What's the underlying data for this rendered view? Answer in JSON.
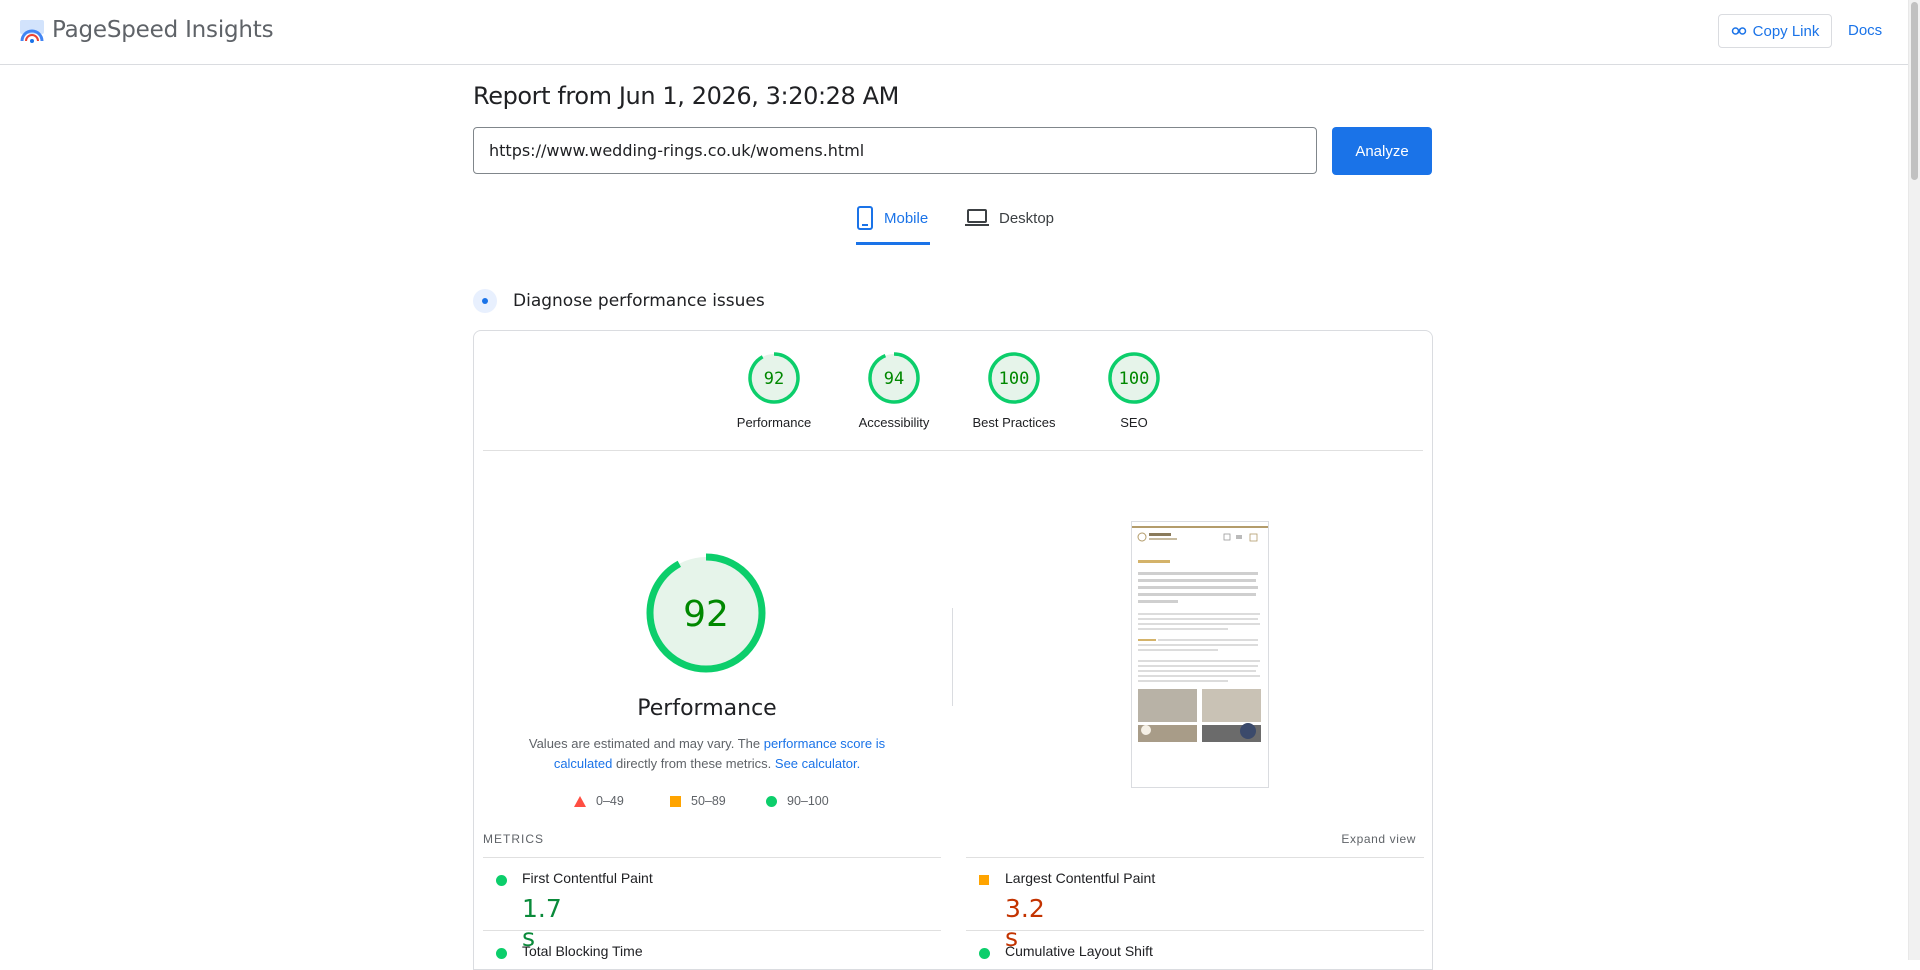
{
  "header": {
    "brand": "PageSpeed Insights",
    "copy_link": "Copy Link",
    "docs": "Docs"
  },
  "report": {
    "title": "Report from Jun 1, 2026, 3:20:28 AM",
    "url": "https://www.wedding-rings.co.uk/womens.html",
    "analyze": "Analyze"
  },
  "tabs": [
    {
      "label": "Mobile",
      "active": true,
      "icon": "smartphone-icon"
    },
    {
      "label": "Desktop",
      "active": false,
      "icon": "laptop-icon"
    }
  ],
  "diagnose": {
    "title": "Diagnose performance issues"
  },
  "scores": [
    {
      "label": "Performance",
      "value": 92
    },
    {
      "label": "Accessibility",
      "value": 94
    },
    {
      "label": "Best Practices",
      "value": 100
    },
    {
      "label": "SEO",
      "value": 100
    }
  ],
  "performance": {
    "score": 92,
    "title": "Performance",
    "note_prefix": "Values are estimated and may vary. The ",
    "note_link1": "performance score is calculated",
    "note_middle": " directly from these metrics. ",
    "note_link2": "See calculator.",
    "legend": [
      {
        "range": "0–49",
        "color": "#ff4e42",
        "shape": "triangle"
      },
      {
        "range": "50–89",
        "color": "#ffa400",
        "shape": "square"
      },
      {
        "range": "90–100",
        "color": "#0cce6b",
        "shape": "circle"
      }
    ]
  },
  "metrics": {
    "label": "METRICS",
    "expand": "Expand view",
    "items": [
      {
        "name": "First Contentful Paint",
        "value": "1.7 s",
        "status": "good",
        "color": "#0a8a3a"
      },
      {
        "name": "Largest Contentful Paint",
        "value": "3.2 s",
        "status": "average",
        "color": "#c33300"
      },
      {
        "name": "Total Blocking Time",
        "value": "",
        "status": "good",
        "color": "#0a8a3a"
      },
      {
        "name": "Cumulative Layout Shift",
        "value": "",
        "status": "good",
        "color": "#0a8a3a"
      }
    ]
  },
  "colors": {
    "accent": "#1a73e8",
    "pass": "#0cce6b",
    "pass_fill": "#e6f4ea",
    "pass_text": "#008800",
    "average": "#ffa400",
    "fail": "#ff4e42"
  }
}
